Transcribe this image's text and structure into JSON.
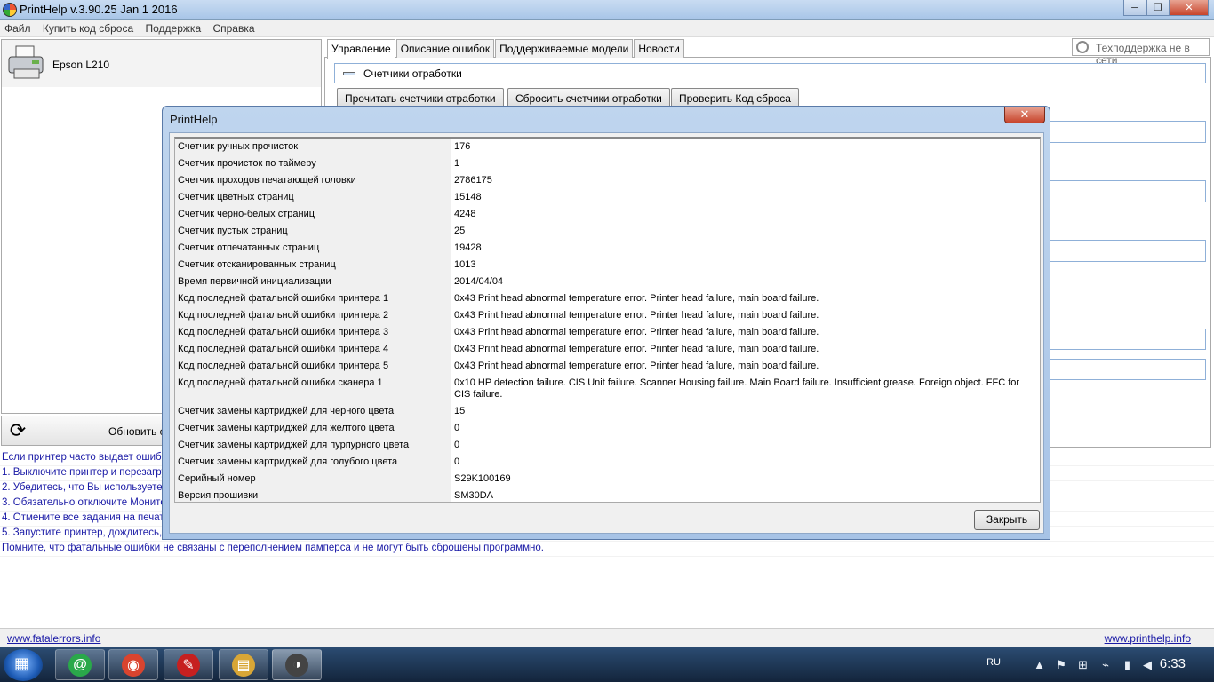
{
  "window": {
    "title": "PrintHelp v.3.90.25 Jan  1 2016",
    "min": "─",
    "max": "❐",
    "close": "✕"
  },
  "menu": [
    "Файл",
    "Купить код сброса",
    "Поддержка",
    "Справка"
  ],
  "printer": {
    "name": "Epson L210"
  },
  "refresh": {
    "label": "Обновить сп",
    "icon": "⟳"
  },
  "tabs": [
    "Управление",
    "Описание ошибок",
    "Поддерживаемые модели",
    "Новости"
  ],
  "support_status": "Техподдержка не в сети",
  "counters_section": {
    "title": "Счетчики отработки",
    "buttons": [
      "Прочитать счетчики отработки",
      "Сбросить счетчики отработки",
      "Проверить Код сброса"
    ]
  },
  "instructions": [
    "Если принтер часто выдает ошибк",
    "1. Выключите принтер и перезагру",
    "2. Убедитесь, что Вы используете",
    "3. Обязательно отключите Монитор",
    "4. Отмените все задания на печат",
    "5. Запустите принтер, дождитесь,",
    "Помните, что фатальные ошибки не связаны с переполнением памперса и не могут быть сброшены программно."
  ],
  "links": {
    "left": "www.fatalerrors.info",
    "right": "www.printhelp.info"
  },
  "dialog": {
    "title": "PrintHelp",
    "close_glyph": "✕",
    "close_button": "Закрыть",
    "rows": [
      {
        "k": "Счетчик ручных прочисток",
        "v": "176"
      },
      {
        "k": "Счетчик прочисток по таймеру",
        "v": "1"
      },
      {
        "k": "Счетчик проходов печатающей головки",
        "v": "2786175"
      },
      {
        "k": "Счетчик цветных страниц",
        "v": "15148"
      },
      {
        "k": "Счетчик черно-белых страниц",
        "v": "4248"
      },
      {
        "k": "Счетчик пустых страниц",
        "v": "25"
      },
      {
        "k": "Счетчик отпечатанных страниц",
        "v": "19428"
      },
      {
        "k": "Счетчик отсканированных страниц",
        "v": "1013"
      },
      {
        "k": "Время первичной инициализации",
        "v": "2014/04/04"
      },
      {
        "k": "Код последней фатальной ошибки принтера 1",
        "v": "0x43 Print head abnormal temperature error. Printer head failure, main board failure."
      },
      {
        "k": "Код последней фатальной ошибки принтера 2",
        "v": "0x43 Print head abnormal temperature error. Printer head failure, main board failure."
      },
      {
        "k": "Код последней фатальной ошибки принтера 3",
        "v": "0x43 Print head abnormal temperature error. Printer head failure, main board failure."
      },
      {
        "k": "Код последней фатальной ошибки принтера 4",
        "v": "0x43 Print head abnormal temperature error. Printer head failure, main board failure."
      },
      {
        "k": "Код последней фатальной ошибки принтера 5",
        "v": "0x43 Print head abnormal temperature error. Printer head failure, main board failure."
      },
      {
        "k": "Код последней фатальной ошибки сканера 1",
        "v": "0x10 HP detection failure. CIS Unit failure. Scanner Housing failure. Main Board failure. Insufficient grease. Foreign object. FFC for CIS failure."
      },
      {
        "k": "Счетчик замены картриджей для черного цвета",
        "v": "15"
      },
      {
        "k": "Счетчик замены картриджей для желтого цвета",
        "v": "0"
      },
      {
        "k": "Счетчик замены картриджей для пурпурного цвета",
        "v": "0"
      },
      {
        "k": "Счетчик замены картриджей для голубого цвета",
        "v": "0"
      },
      {
        "k": "Серийный номер",
        "v": "S29K100169"
      },
      {
        "k": "Версия прошивки",
        "v": "SM30DA"
      }
    ]
  },
  "taskbar": {
    "items": [
      {
        "name": "mail-agent",
        "glyph": "@",
        "color": "#2aa84a"
      },
      {
        "name": "chrome",
        "glyph": "◉",
        "color": "#d9442f"
      },
      {
        "name": "pdf-reader",
        "glyph": "✎",
        "color": "#c62020"
      },
      {
        "name": "file-explorer",
        "glyph": "▤",
        "color": "#d8a636"
      },
      {
        "name": "printhelp",
        "glyph": "◑",
        "color": "#444444"
      }
    ],
    "lang": "RU",
    "clock": "6:33"
  }
}
